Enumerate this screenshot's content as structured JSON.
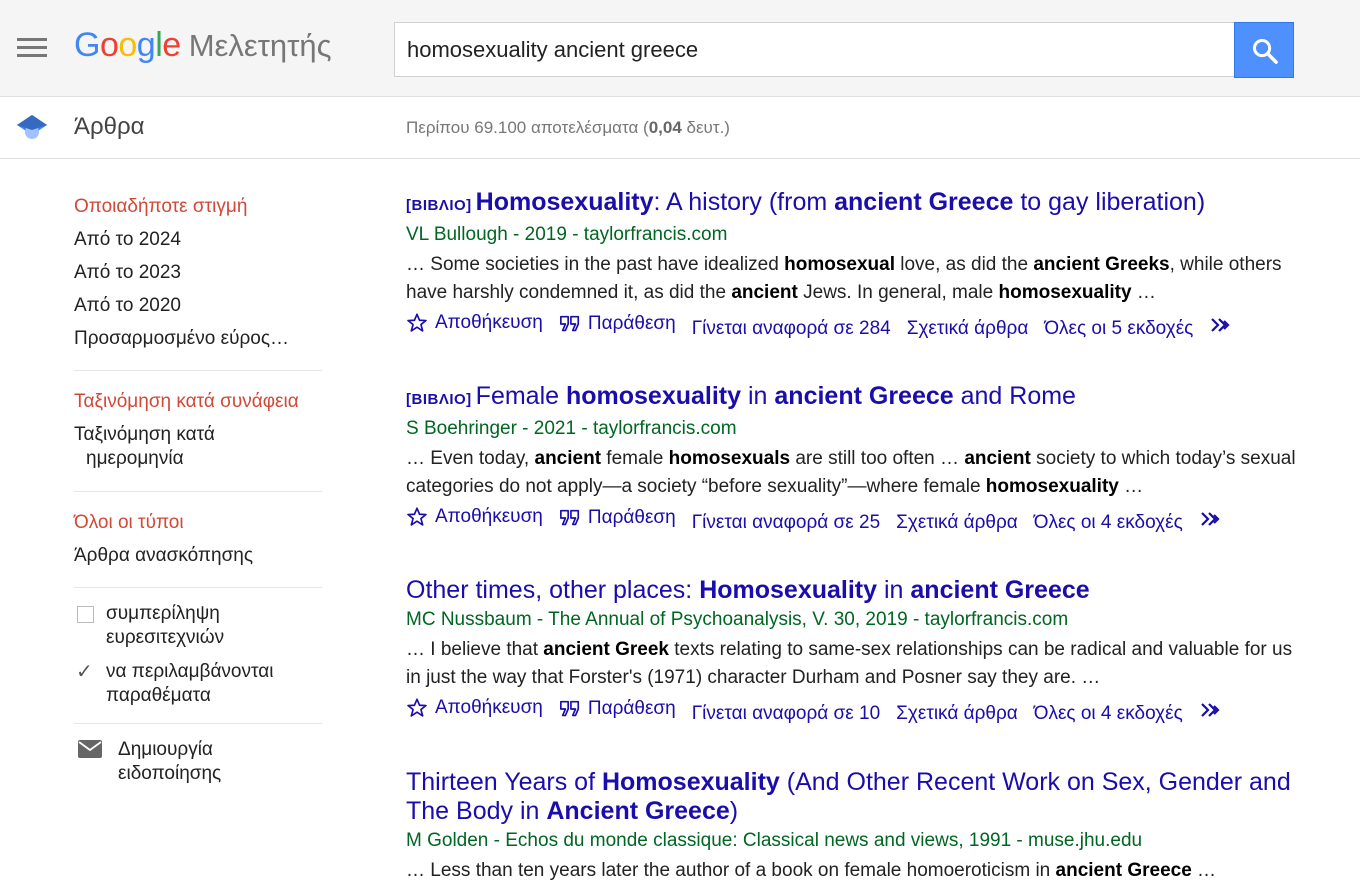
{
  "header": {
    "logo_brand": "Google",
    "logo_product": "Μελετητής",
    "search_value": "homosexuality ancient greece"
  },
  "subbar": {
    "section_title": "Άρθρα",
    "count_prefix": "Περίπου 69.100 αποτελέσματα (",
    "count_time": "0,04",
    "count_suffix": " δευτ.)"
  },
  "sidebar": {
    "time_filters": [
      {
        "label": "Οποιαδήποτε στιγμή",
        "active": true
      },
      {
        "label": "Από το 2024",
        "active": false
      },
      {
        "label": "Από το 2023",
        "active": false
      },
      {
        "label": "Από το 2020",
        "active": false
      },
      {
        "label": "Προσαρμοσμένο εύρος…",
        "active": false
      }
    ],
    "sort_relevance": "Ταξινόμηση κατά συνάφεια",
    "sort_date_1": "Ταξινόμηση κατά",
    "sort_date_2": "ημερομηνία",
    "type_all": "Όλοι οι τύποι",
    "type_reviews": "Άρθρα ανασκόπησης",
    "patents_1": "συμπερίληψη",
    "patents_2": "ευρεσιτεχνιών",
    "citations_1": "να περιλαμβάνονται",
    "citations_2": "παραθέματα",
    "citations_checked": true,
    "alert_1": "Δημιουργία",
    "alert_2": "ειδοποίησης"
  },
  "link_labels": {
    "save": "Αποθήκευση",
    "cite": "Παράθεση",
    "related": "Σχετικά άρθρα"
  },
  "results": [
    {
      "tag": "[ΒΙΒΛΙΟ]",
      "title_parts": [
        [
          "Homosexuality",
          true
        ],
        [
          ": A history (from ",
          false
        ],
        [
          "ancient Greece",
          true
        ],
        [
          " to gay liberation)",
          false
        ]
      ],
      "meta": "VL Bullough - 2019 - taylorfrancis.com",
      "snippet_parts": [
        [
          "… Some societies in the past have idealized ",
          false
        ],
        [
          "homosexual",
          true
        ],
        [
          " love, as did the ",
          false
        ],
        [
          "ancient Greeks",
          true
        ],
        [
          ", while others have harshly condemned it, as did the ",
          false
        ],
        [
          "ancient",
          true
        ],
        [
          " Jews. In general, male ",
          false
        ],
        [
          "homosexuality",
          true
        ],
        [
          " …",
          false
        ]
      ],
      "cited_by": "Γίνεται αναφορά σε 284",
      "versions": "Όλες οι 5 εκδοχές"
    },
    {
      "tag": "[ΒΙΒΛΙΟ]",
      "title_parts": [
        [
          "Female ",
          false
        ],
        [
          "homosexuality",
          true
        ],
        [
          " in ",
          false
        ],
        [
          "ancient Greece",
          true
        ],
        [
          " and Rome",
          false
        ]
      ],
      "meta": "S Boehringer - 2021 - taylorfrancis.com",
      "snippet_parts": [
        [
          "… Even today, ",
          false
        ],
        [
          "ancient",
          true
        ],
        [
          " female ",
          false
        ],
        [
          "homosexuals",
          true
        ],
        [
          " are still too often … ",
          false
        ],
        [
          "ancient",
          true
        ],
        [
          " society to which today’s sexual categories do not apply—a society “before sexuality”—where female ",
          false
        ],
        [
          "homosexuality",
          true
        ],
        [
          " …",
          false
        ]
      ],
      "cited_by": "Γίνεται αναφορά σε 25",
      "versions": "Όλες οι 4 εκδοχές"
    },
    {
      "tag": "",
      "title_parts": [
        [
          "Other times, other places: ",
          false
        ],
        [
          "Homosexuality",
          true
        ],
        [
          " in ",
          false
        ],
        [
          "ancient Greece",
          true
        ]
      ],
      "meta": "MC Nussbaum - The Annual of Psychoanalysis, V. 30, 2019 - taylorfrancis.com",
      "snippet_parts": [
        [
          "… I believe that ",
          false
        ],
        [
          "ancient Greek",
          true
        ],
        [
          " texts relating to same-sex relationships can be radical and valuable for us in just the way that Forster's (1971) character Durham and Posner say they are. …",
          false
        ]
      ],
      "cited_by": "Γίνεται αναφορά σε 10",
      "versions": "Όλες οι 4 εκδοχές"
    },
    {
      "tag": "",
      "title_parts": [
        [
          "Thirteen Years of ",
          false
        ],
        [
          "Homosexuality",
          true
        ],
        [
          " (And Other Recent Work on Sex, Gender and The Body in ",
          false
        ],
        [
          "Ancient Greece",
          true
        ],
        [
          ")",
          false
        ]
      ],
      "meta": "M Golden - Echos du monde classique: Classical news and views, 1991 - muse.jhu.edu",
      "snippet_parts": [
        [
          "… Less than ten years later the author of a book on female homoeroticism in ",
          false
        ],
        [
          "ancient Greece",
          true
        ],
        [
          " …",
          false
        ]
      ],
      "cited_by": "",
      "versions": ""
    }
  ]
}
